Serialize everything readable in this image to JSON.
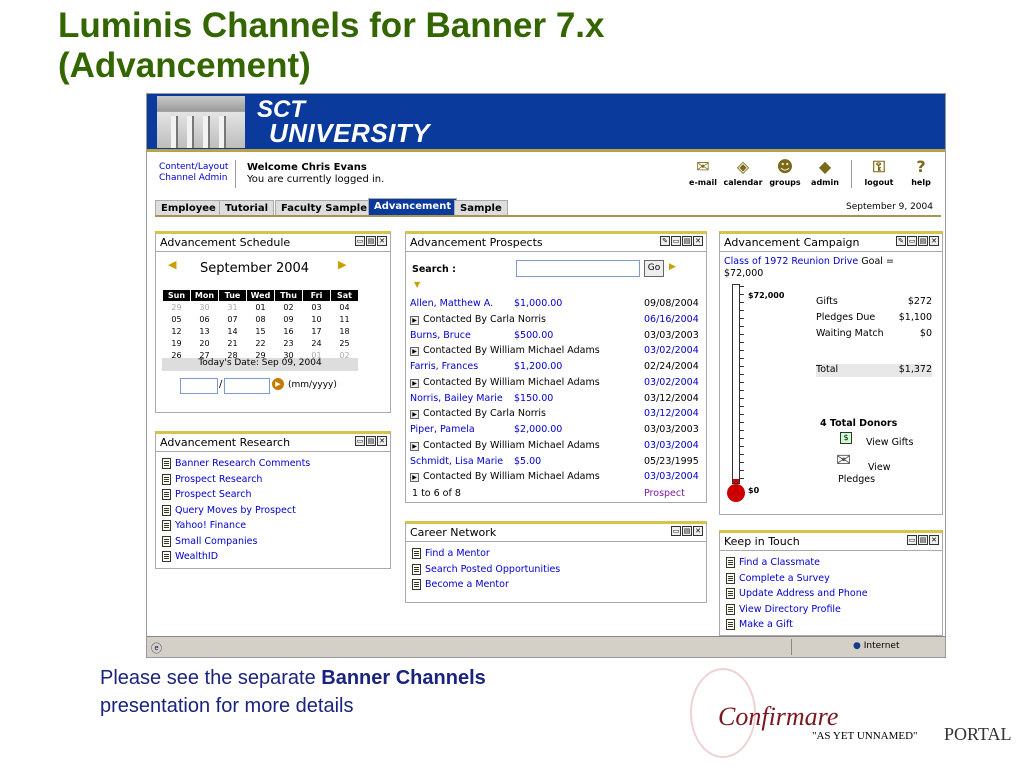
{
  "slide": {
    "title_line1": "Luminis Channels for Banner 7.x",
    "title_line2": "(Advancement)",
    "footer_prefix": "Please see the separate ",
    "footer_bold": "Banner Channels",
    "footer_line2": "presentation for more details",
    "logo_confirmare": "Confirmare",
    "logo_unnamed": "\"AS YET UNNAMED\"",
    "logo_portal": "PORTAL"
  },
  "banner": {
    "sct": "SCT",
    "university": "UNIVERSITY"
  },
  "header": {
    "admin_link1": "Content/Layout",
    "admin_link2": "Channel Admin",
    "welcome": "Welcome Chris Evans",
    "status": "You are currently logged in."
  },
  "toolbar": {
    "email": "e-mail",
    "calendar": "calendar",
    "groups": "groups",
    "admin": "admin",
    "logout": "logout",
    "help": "help"
  },
  "tabs": [
    "Employee",
    "Tutorial",
    "Faculty Sample",
    "Advancement",
    "Sample"
  ],
  "date": "September 9, 2004",
  "schedule": {
    "title": "Advancement Schedule",
    "month": "September 2004",
    "days": [
      "Sun",
      "Mon",
      "Tue",
      "Wed",
      "Thu",
      "Fri",
      "Sat"
    ],
    "weeks": [
      [
        "29",
        "30",
        "31",
        "01",
        "02",
        "03",
        "04"
      ],
      [
        "05",
        "06",
        "07",
        "08",
        "09",
        "10",
        "11"
      ],
      [
        "12",
        "13",
        "14",
        "15",
        "16",
        "17",
        "18"
      ],
      [
        "19",
        "20",
        "21",
        "22",
        "23",
        "24",
        "25"
      ],
      [
        "26",
        "27",
        "28",
        "29",
        "30",
        "01",
        "02"
      ]
    ],
    "today": "Today's Date: Sep 09, 2004",
    "sep": "/",
    "format": "(mm/yyyy)"
  },
  "research": {
    "title": "Advancement Research",
    "items": [
      "Banner Research Comments",
      "Prospect Research",
      "Prospect Search",
      "Query Moves by Prospect",
      "Yahoo! Finance",
      "Small Companies",
      "WealthID"
    ]
  },
  "prospects": {
    "title": "Advancement Prospects",
    "search_label": "Search :",
    "go": "Go",
    "rows": [
      {
        "name": "Allen, Matthew A.",
        "amount": "$1,000.00",
        "date": "09/08/2004",
        "contact": "Contacted By Carla Norris",
        "cdate": "06/16/2004"
      },
      {
        "name": "Burns, Bruce",
        "amount": "$500.00",
        "date": "03/03/2003",
        "contact": "Contacted By William Michael Adams",
        "cdate": "03/02/2004"
      },
      {
        "name": "Farris, Frances",
        "amount": "$1,200.00",
        "date": "02/24/2004",
        "contact": "Contacted By William Michael Adams",
        "cdate": "03/02/2004"
      },
      {
        "name": "Norris, Bailey Marie",
        "amount": "$150.00",
        "date": "03/12/2004",
        "contact": "Contacted By Carla Norris",
        "cdate": "03/12/2004"
      },
      {
        "name": "Piper, Pamela",
        "amount": "$2,000.00",
        "date": "03/03/2003",
        "contact": "Contacted By William Michael Adams",
        "cdate": "03/03/2004"
      },
      {
        "name": "Schmidt, Lisa Marie",
        "amount": "$5.00",
        "date": "05/23/1995",
        "contact": "Contacted By William Michael Adams",
        "cdate": "03/03/2004"
      }
    ],
    "range": "1 to 6 of 8",
    "prospect_link": "Prospect"
  },
  "career": {
    "title": "Career Network",
    "items": [
      "Find a Mentor",
      "Search Posted Opportunities",
      "Become a Mentor"
    ]
  },
  "campaign": {
    "title": "Advancement Campaign",
    "drive": "Class of 1972 Reunion Drive",
    "goal": " Goal =",
    "goal_amount": "$72,000",
    "therm_top": "$72,000",
    "therm_bottom": "$0",
    "therm_level": 0.02,
    "rows": [
      {
        "label": "Gifts",
        "value": "$272"
      },
      {
        "label": "Pledges Due",
        "value": "$1,100"
      },
      {
        "label": "Waiting Match",
        "value": "$0"
      }
    ],
    "total_label": "Total",
    "total_value": "$1,372",
    "donors": "4 Total Donors",
    "view_gifts": "View Gifts",
    "view": "View",
    "pledges": "Pledges"
  },
  "touch": {
    "title": "Keep in Touch",
    "items": [
      "Find a Classmate",
      "Complete a Survey",
      "Update Address and Phone",
      "View Directory Profile",
      "Make a Gift"
    ]
  },
  "statusbar": {
    "zone": "Internet"
  }
}
